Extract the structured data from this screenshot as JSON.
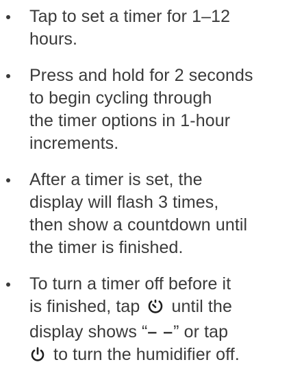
{
  "bullets": [
    {
      "lines": [
        "Tap to set a timer for 1–12",
        "hours."
      ]
    },
    {
      "lines": [
        "Press and hold for 2 seconds",
        "to begin cycling through",
        "the timer options in 1-hour",
        "increments."
      ]
    },
    {
      "lines": [
        "After a timer is set, the",
        "display will flash 3 times,",
        "then show a countdown until",
        "the timer is finished."
      ]
    },
    {
      "line1": "To turn a timer off before it",
      "line2_pre": "is finished, tap",
      "line2_post": "until the",
      "line3_pre": "display shows “",
      "line3_dashes": "– –",
      "line3_post": "” or tap",
      "line4_post": "to turn the humidifier off.",
      "timer_icon": "timer-icon",
      "power_icon": "power-icon"
    }
  ]
}
